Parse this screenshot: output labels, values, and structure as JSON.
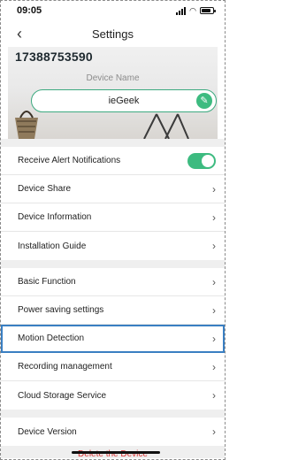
{
  "status": {
    "time": "09:05"
  },
  "nav": {
    "title": "Settings"
  },
  "device": {
    "id": "17388753590",
    "name_label": "Device Name",
    "name_value": "ieGeek"
  },
  "alerts": {
    "label": "Receive Alert Notifications",
    "enabled": true
  },
  "group1": [
    {
      "label": "Device Share"
    },
    {
      "label": "Device Information"
    },
    {
      "label": "Installation Guide"
    }
  ],
  "group2": [
    {
      "label": "Basic Function"
    },
    {
      "label": "Power saving settings"
    },
    {
      "label": "Motion Detection"
    },
    {
      "label": "Recording management"
    },
    {
      "label": "Cloud Storage Service"
    }
  ],
  "group3": [
    {
      "label": "Device Version"
    }
  ],
  "footer": {
    "delete_label": "Delete the Device"
  },
  "colors": {
    "accent": "#3dbb80",
    "highlight": "#3a7fc2",
    "danger": "#d63030"
  }
}
